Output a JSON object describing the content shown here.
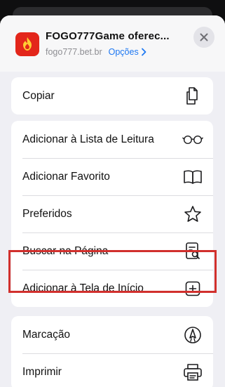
{
  "header": {
    "title": "FOGO777Game oferec...",
    "domain": "fogo777.bet.br",
    "options_label": "Opções"
  },
  "actions": {
    "copy": "Copiar",
    "reading_list": "Adicionar à Lista de Leitura",
    "add_bookmark": "Adicionar Favorito",
    "favorites": "Preferidos",
    "find_on_page": "Buscar na Página",
    "add_to_home": "Adicionar à Tela de Início",
    "markup": "Marcação",
    "print": "Imprimir"
  },
  "colors": {
    "accent": "#1e78f2",
    "highlight": "#d1302d",
    "app_icon": "#e3261b"
  },
  "icons": {
    "copy": "copy-icon",
    "reading_list": "glasses-icon",
    "add_bookmark": "book-icon",
    "favorites": "star-icon",
    "find_on_page": "find-doc-icon",
    "add_to_home": "plus-square-icon",
    "markup": "pen-circle-icon",
    "print": "printer-icon",
    "close": "close-icon",
    "options": "chevron-right-icon"
  }
}
